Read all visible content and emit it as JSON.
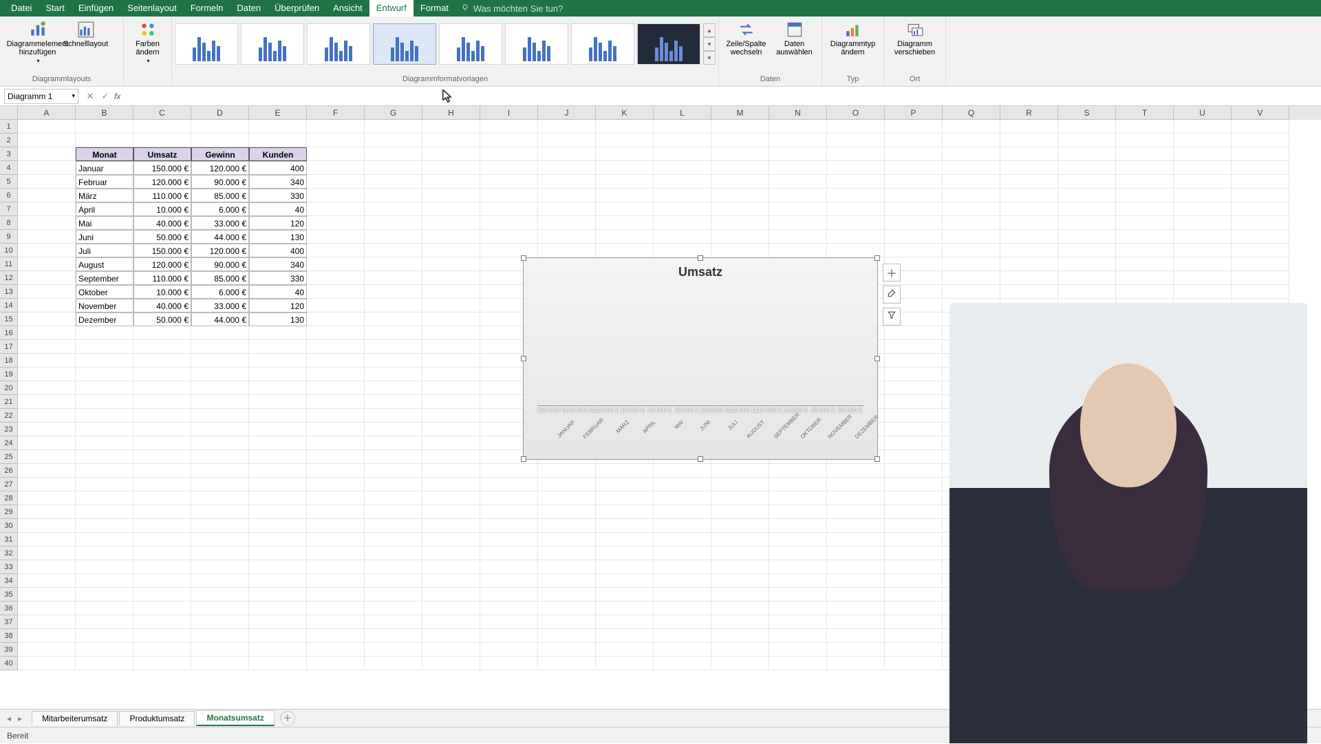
{
  "tabs": {
    "file": "Datei",
    "home": "Start",
    "insert": "Einfügen",
    "layout": "Seitenlayout",
    "formulas": "Formeln",
    "data": "Daten",
    "review": "Überprüfen",
    "view": "Ansicht",
    "design": "Entwurf",
    "format": "Format",
    "search_ph": "Was möchten Sie tun?"
  },
  "ribbon": {
    "add_element": "Diagrammelement hinzufügen",
    "quick_layout": "Schnelllayout",
    "layouts_group": "Diagrammlayouts",
    "change_colors": "Farben ändern",
    "styles_group": "Diagrammformatvorlagen",
    "switch_rowcol": "Zeile/Spalte wechseln",
    "select_data": "Daten auswählen",
    "data_group": "Daten",
    "change_type": "Diagrammtyp ändern",
    "type_group": "Typ",
    "move_chart": "Diagramm verschieben",
    "loc_group": "Ort"
  },
  "name_box": "Diagramm 1",
  "table": {
    "headers": [
      "Monat",
      "Umsatz",
      "Gewinn",
      "Kunden"
    ],
    "rows": [
      [
        "Januar",
        "150.000 €",
        "120.000 €",
        "400"
      ],
      [
        "Februar",
        "120.000 €",
        "90.000 €",
        "340"
      ],
      [
        "März",
        "110.000 €",
        "85.000 €",
        "330"
      ],
      [
        "April",
        "10.000 €",
        "6.000 €",
        "40"
      ],
      [
        "Mai",
        "40.000 €",
        "33.000 €",
        "120"
      ],
      [
        "Juni",
        "50.000 €",
        "44.000 €",
        "130"
      ],
      [
        "Juli",
        "150.000 €",
        "120.000 €",
        "400"
      ],
      [
        "August",
        "120.000 €",
        "90.000 €",
        "340"
      ],
      [
        "September",
        "110.000 €",
        "85.000 €",
        "330"
      ],
      [
        "Oktober",
        "10.000 €",
        "6.000 €",
        "40"
      ],
      [
        "November",
        "40.000 €",
        "33.000 €",
        "120"
      ],
      [
        "Dezember",
        "50.000 €",
        "44.000 €",
        "130"
      ]
    ]
  },
  "sheets": {
    "s1": "Mitarbeiterumsatz",
    "s2": "Produktumsatz",
    "s3": "Monatsumsatz"
  },
  "status": "Bereit",
  "chart_data": {
    "type": "bar",
    "title": "Umsatz",
    "xlabel": "",
    "ylabel": "",
    "ylim": [
      0,
      160000
    ],
    "categories": [
      "JANUAR",
      "FEBRUAR",
      "MÄRZ",
      "APRIL",
      "MAI",
      "JUNI",
      "JULI",
      "AUGUST",
      "SEPTEMBER",
      "OKTOBER",
      "NOVEMBER",
      "DEZEMBER"
    ],
    "values": [
      150000,
      120000,
      110000,
      10000,
      40000,
      50000,
      150000,
      120000,
      110000,
      10000,
      40000,
      50000
    ],
    "value_labels": [
      "150.000 €",
      "120.000 €",
      "110.000 €",
      "10.000 €",
      "40.000 €",
      "50.000 €",
      "150.000 €",
      "120.000 €",
      "110.000 €",
      "10.000 €",
      "40.000 €",
      "50.000 €"
    ]
  },
  "columns": [
    "A",
    "B",
    "C",
    "D",
    "E",
    "F",
    "G",
    "H",
    "I",
    "J",
    "K",
    "L",
    "M",
    "N",
    "O",
    "P",
    "Q",
    "R",
    "S",
    "T",
    "U",
    "V"
  ]
}
